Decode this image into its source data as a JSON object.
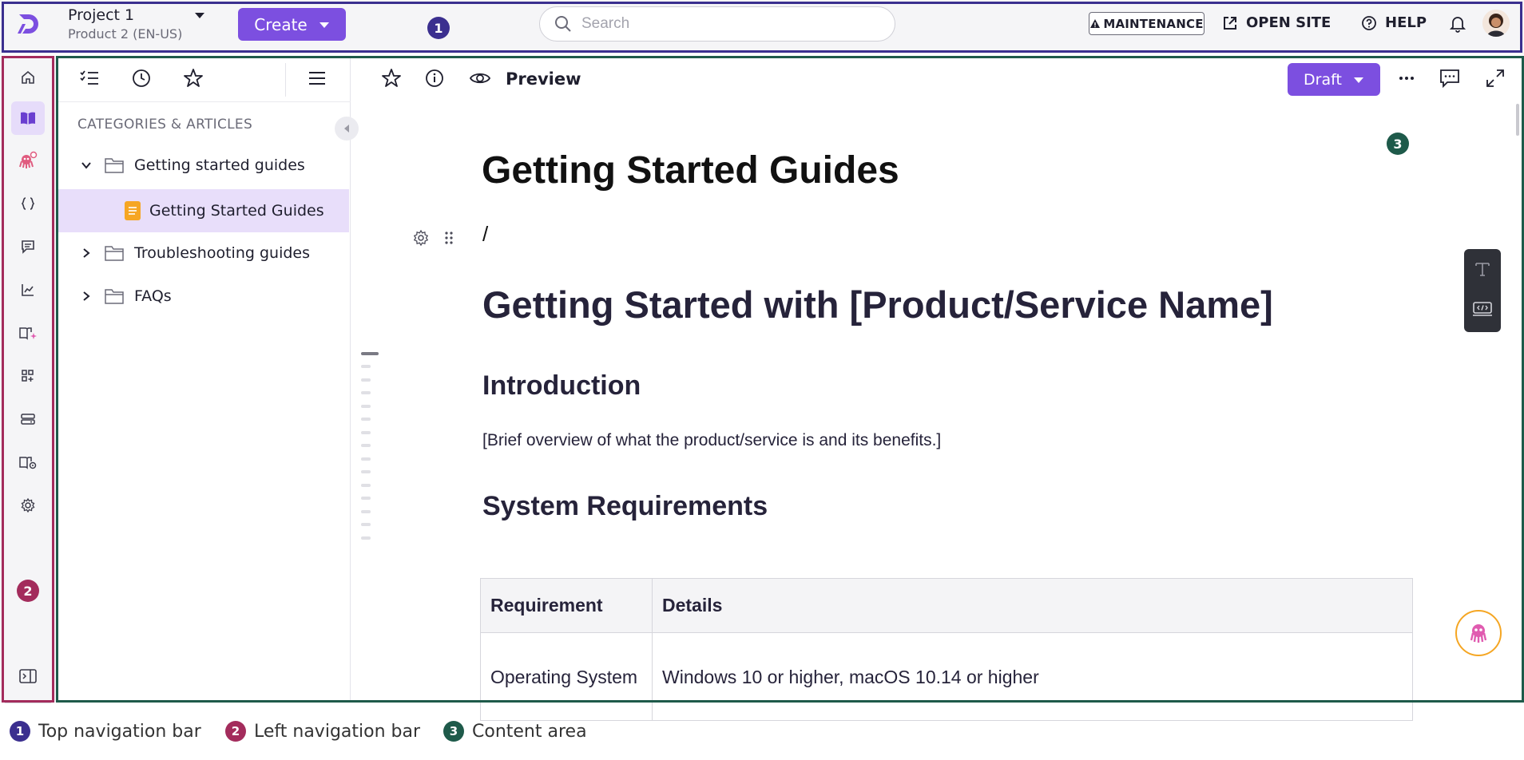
{
  "colors": {
    "accent": "#7c4fe0",
    "callout_top": "#3b2f8f",
    "callout_left": "#a32c5c",
    "callout_content": "#1e5a4a",
    "bot_ring": "#f5a623",
    "article_icon": "#f6a623"
  },
  "topbar": {
    "project_title": "Project 1",
    "project_subtitle": "Product 2 (EN-US)",
    "create_label": "Create",
    "search_placeholder": "Search",
    "maintenance_label": "MAINTENANCE",
    "open_site_label": "OPEN SITE",
    "help_label": "HELP"
  },
  "callouts": {
    "top": "1",
    "left": "2",
    "content": "3"
  },
  "leftnav": {
    "items": [
      "home-icon",
      "book-icon",
      "bot-icon",
      "code-braces-icon",
      "comment-icon",
      "analytics-icon",
      "ai-article-icon",
      "apps-add-icon",
      "storage-icon",
      "site-settings-icon",
      "gear-icon"
    ],
    "active_index": 1,
    "footer_icon": "panel-toggle-icon"
  },
  "tree": {
    "heading": "CATEGORIES & ARTICLES",
    "rows": [
      {
        "label": "Getting started guides",
        "type": "folder",
        "expanded": true
      },
      {
        "label": "Getting Started Guides",
        "type": "article",
        "selected": true
      },
      {
        "label": "Troubleshooting guides",
        "type": "folder",
        "expanded": false
      },
      {
        "label": "FAQs",
        "type": "folder",
        "expanded": false
      }
    ]
  },
  "editor": {
    "preview_label": "Preview",
    "status_label": "Draft",
    "title": "Getting Started Guides",
    "slash": "/",
    "h1": "Getting Started with [Product/Service Name]",
    "intro_heading": "Introduction",
    "intro_text": "[Brief overview of what the product/service is and its benefits.]",
    "sysreq_heading": "System Requirements",
    "table": {
      "headers": [
        "Requirement",
        "Details"
      ],
      "rows": [
        [
          "Operating System",
          "Windows 10 or higher, macOS 10.14 or higher"
        ]
      ]
    }
  },
  "legend": [
    {
      "num": "1",
      "label": "Top navigation bar"
    },
    {
      "num": "2",
      "label": "Left navigation bar"
    },
    {
      "num": "3",
      "label": "Content area"
    }
  ]
}
